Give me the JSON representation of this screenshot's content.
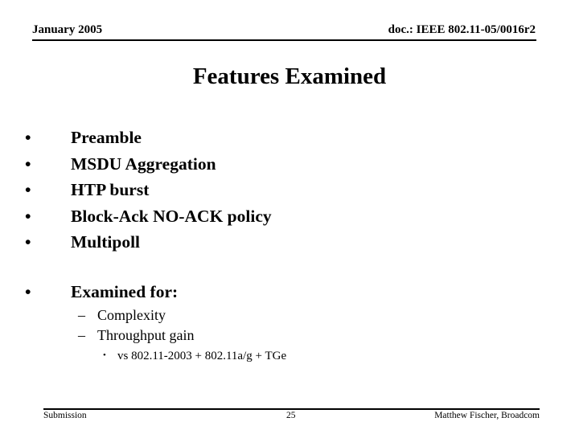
{
  "header": {
    "date": "January 2005",
    "doc_id": "doc.: IEEE 802.11-05/0016r2"
  },
  "slide": {
    "title": "Features Examined",
    "bullet_glyph": "•",
    "dash_glyph": "–",
    "features": [
      "Preamble",
      "MSDU Aggregation",
      "HTP burst",
      "Block-Ack NO-ACK policy",
      "Multipoll"
    ],
    "examined_for": {
      "label": "Examined for:",
      "items": [
        "Complexity",
        "Throughput gain"
      ],
      "sub_item": "vs 802.11-2003 + 802.11a/g + TGe"
    }
  },
  "footer": {
    "left": "Submission",
    "page_number": "25",
    "right": "Matthew Fischer, Broadcom"
  }
}
